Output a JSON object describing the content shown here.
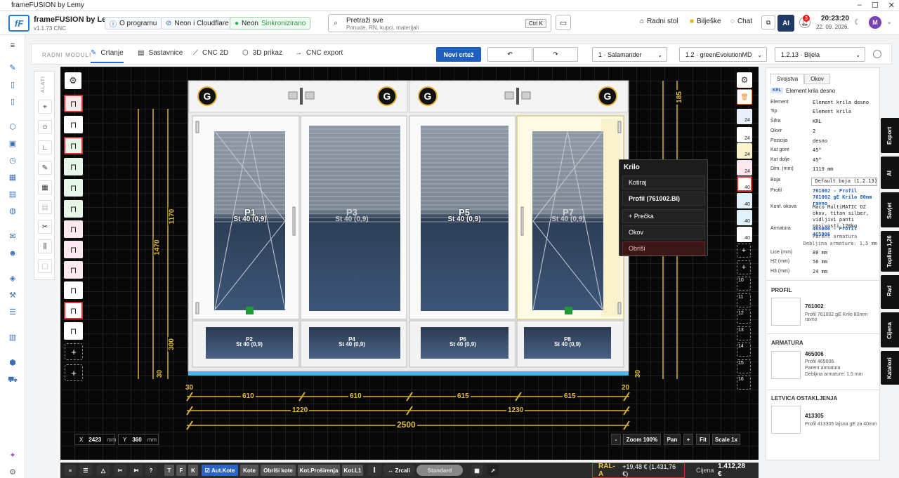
{
  "window": {
    "title": "frameFUSION by Lemy"
  },
  "header": {
    "app_name": "frameFUSION by Lemy",
    "app_version": "v1.1.73 CNC",
    "about": "O programu",
    "neon_cloudflare": "Neon i Cloudflare",
    "neon_status_name": "Neon",
    "neon_status_value": "Sinkronizirano",
    "search_title": "Pretraži sve",
    "search_hint": "Ponude, RN, kupci, materijali",
    "search_kbd": "Ctrl K",
    "desk": "Radni stol",
    "notes": "Bilješke",
    "chat": "Chat",
    "ai": "AI",
    "notif_count": "3",
    "time": "20:23:20",
    "date": "22. 09. 2026.",
    "avatar": "M"
  },
  "modules": {
    "label": "RADNI MODULI",
    "tabs": [
      "Crtanje",
      "Sastavnice",
      "CNC 2D",
      "3D prikaz",
      "CNC export"
    ],
    "new_drawing": "Novi crtež",
    "system": "1 · Salamander",
    "profile": "1.2 · greenEvolutionMD",
    "color": "1.2.13 · Bijela"
  },
  "tools": {
    "label": "ALATI"
  },
  "drawing": {
    "gap_labels": [
      "G",
      "G",
      "G",
      "G"
    ],
    "panes": [
      {
        "name": "P1",
        "glass": "St 40 (0,9)"
      },
      {
        "name": "P3",
        "glass": "St 40 (0,9)"
      },
      {
        "name": "P5",
        "glass": "St 40 (0,9)"
      },
      {
        "name": "P7",
        "glass": "St 40 (0,9)"
      },
      {
        "name": "P2",
        "glass": "St 40 (0,9)"
      },
      {
        "name": "P4",
        "glass": "St 40 (0,9)"
      },
      {
        "name": "P6",
        "glass": "St 40 (0,9)"
      },
      {
        "name": "P8",
        "glass": "St 40 (0,9)"
      }
    ],
    "dims_bottom_row1": [
      "30",
      "610",
      "610",
      "615",
      "615",
      "20"
    ],
    "dims_bottom_row2": [
      "1220",
      "1230"
    ],
    "dims_total_width": "2500",
    "dims_left_outer": "1470",
    "dims_left_inner": "1170",
    "dims_left_lower": "300",
    "dims_left_bottom": "30",
    "dims_right_top": "185",
    "dims_right_bottom": "30",
    "right_labels": [
      "24",
      "24",
      "24",
      "24",
      "40",
      "40",
      "40",
      "40"
    ],
    "slots": [
      "10",
      "11",
      "12",
      "13",
      "14",
      "15",
      "16"
    ]
  },
  "context_menu": {
    "title": "Krilo",
    "items": [
      "Kotiraj",
      "Profil (761002.BI)",
      "+ Prečka",
      "Okov",
      "Obriši"
    ]
  },
  "coords": {
    "x_label": "X",
    "x_value": "2423",
    "y_label": "Y",
    "y_value": "360",
    "unit": "mm"
  },
  "zoom": {
    "minus": "-",
    "zoom": "Zoom 100%",
    "pan": "Pan",
    "plus": "+",
    "fit": "Fit",
    "scale": "Scale 1x"
  },
  "properties": {
    "tabs": [
      "Svojstva",
      "Okov"
    ],
    "badge": "KRL",
    "heading": "Element krila desno",
    "rows": [
      {
        "k": "Element",
        "v": "Element krila desno"
      },
      {
        "k": "Tip",
        "v": "Element krila"
      },
      {
        "k": "Šifra",
        "v": "KRL"
      },
      {
        "k": "Okvir",
        "v": "2"
      },
      {
        "k": "Pozicija",
        "v": "desno"
      },
      {
        "k": "Kut gore",
        "v": "45°"
      },
      {
        "k": "Kut dolje",
        "v": "45°"
      },
      {
        "k": "Dim. (mm)",
        "v": "1119 mm"
      }
    ],
    "color_label": "Boja",
    "color_value": "Default boja (1.2.13)",
    "profil_label": "Profil",
    "profil_value": "761002 - Profil 761002 gE Krilo 80mm ravno",
    "konf_label": "Konf. okova",
    "konf_value": "Maco MultiMATIC OZ okov, titan silber, vidljivi panti nosivosti 120kg",
    "armatura_label": "Armatura",
    "armatura_value": "465006 - Profil 465006",
    "armatura_sub1": "Parent armatura",
    "armatura_sub2": "Debljina armature: 1,5 mm",
    "lice_label": "Lice (mm)",
    "lice_value": "80 mm",
    "h2_label": "H2 (mm)",
    "h2_value": "56 mm",
    "h3_label": "H3 (mm)",
    "h3_value": "24 mm",
    "profil_sect": "PROFIL",
    "profil_code": "761002",
    "profil_desc": "Profil 761002 gE Krilo 80mm ravno",
    "arm_sect": "ARMATURA",
    "arm_code": "465006",
    "arm_desc1": "Profil 465006",
    "arm_desc2": "Parent armatura",
    "arm_desc3": "Debljina armature: 1,5 mm",
    "let_sect": "LETVICA OSTAKLJENJA",
    "let_code": "413305",
    "let_desc": "Profil 413305 lajsna gE za 40mm"
  },
  "side_tabs": [
    "Export",
    "AI",
    "Savjet",
    "Toplina 1,26",
    "Rad",
    "Cijena",
    "Katalozi"
  ],
  "bottom": {
    "t": "T",
    "f": "F",
    "k": "K",
    "aut_kote": "Aut.Kote",
    "kote": "Kote",
    "obrisi_kote": "Obriši kote",
    "kot_prosirenja": "Kot.Proširenja",
    "kot_l1": "Kot.L1",
    "zrcali": "Zrcali",
    "standard": "Standard",
    "ral": "RAL-A",
    "ral_value": "+19,48 € (1.431,76 €)",
    "cijena_label": "Cijena",
    "cijena_value": "1.412,28 €"
  },
  "colors": {
    "accent": "#1f5fbf",
    "dim": "#d7b23a",
    "canvas": "#080808",
    "sill": "#4fb4e6"
  }
}
